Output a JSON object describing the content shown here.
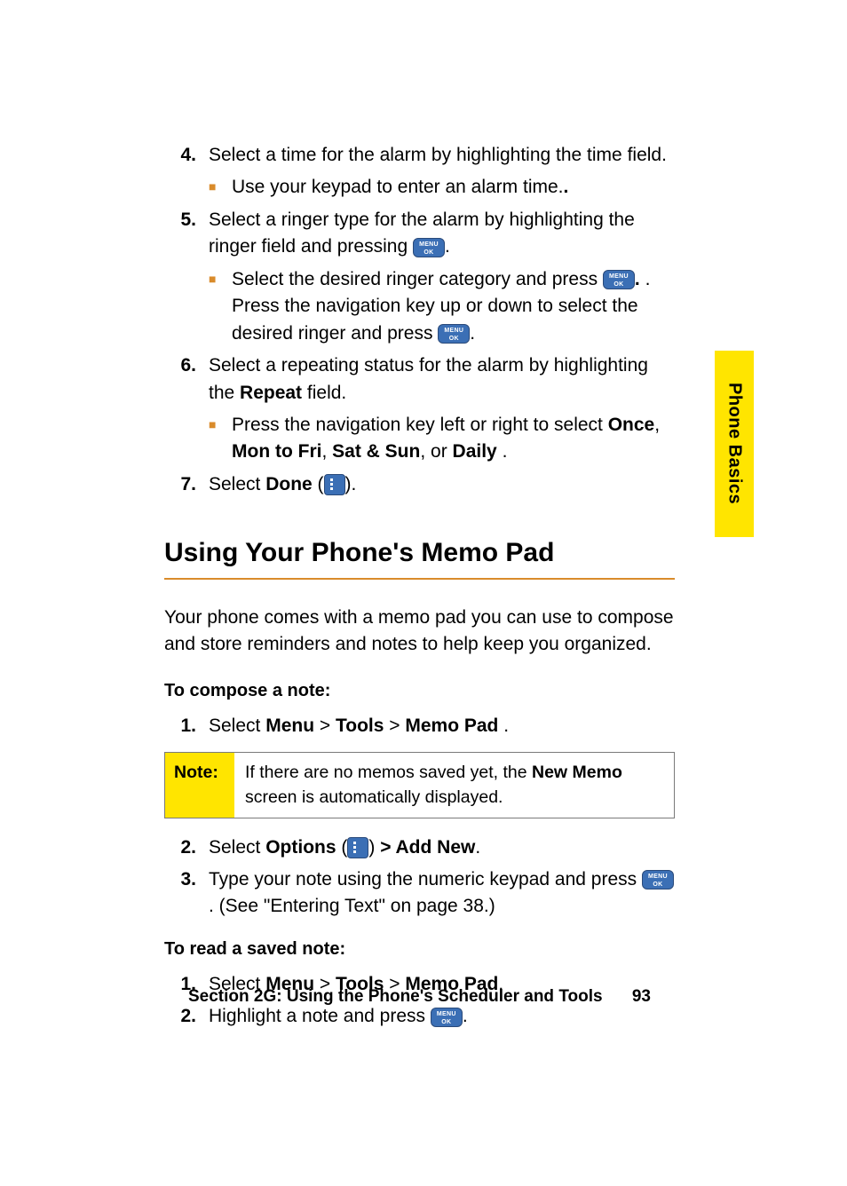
{
  "side_tab": "Phone Basics",
  "steps_top": {
    "s4": {
      "num": "4.",
      "text": "Select a time for the alarm by highlighting the time field.",
      "sub": "Use your keypad to enter an alarm time."
    },
    "s5": {
      "num": "5.",
      "text": "Select a ringer type for the alarm by highlighting the ringer field and pressing ",
      "text_tail": ".",
      "sub_a": "Select the desired ringer category and press ",
      "sub_a_tail": ". Press the navigation key up or down to select the desired ringer and press ",
      "sub_a_tail2": "."
    },
    "s6": {
      "num": "6.",
      "text": "Select a repeating status for the alarm by highlighting the ",
      "bold1": "Repeat",
      "text_tail": " field.",
      "sub_a_pre": "Press the navigation key left or right to select ",
      "opt1": "Once",
      "sep1": ", ",
      "opt2": "Mon to Fri",
      "sep2": ", ",
      "opt3": "Sat & Sun",
      "sep3": ", or ",
      "opt4": "Daily ",
      "sub_a_tail": "."
    },
    "s7": {
      "num": "7.",
      "pre": "Select ",
      "bold": "Done",
      "mid": " (",
      "tail": ")."
    }
  },
  "heading": "Using Your Phone's Memo Pad",
  "intro": "Your phone comes with a memo pad you can use to compose and store reminders and notes to help keep you organized.",
  "compose": {
    "leadin": "To compose a note:",
    "s1": {
      "num": "1.",
      "pre": "Select ",
      "m1": "Menu",
      "gt1": " > ",
      "m2": "Tools",
      "gt2": " > ",
      "m3": "Memo Pad ",
      "tail": "."
    },
    "note_label": "Note:",
    "note_pre": "If there are no memos saved yet, the ",
    "note_bold": "New Memo",
    "note_post": " screen is automatically displayed.",
    "s2": {
      "num": "2.",
      "pre": "Select ",
      "b1": "Options",
      "mid1": " (",
      "mid2": ") ",
      "gt": "> ",
      "b2": "Add New",
      "tail": "."
    },
    "s3": {
      "num": "3.",
      "pre": "Type your note using the numeric keypad and press ",
      "post": ". (See \"Entering Text\" on page 38.)"
    }
  },
  "read": {
    "leadin": "To read a saved note:",
    "s1": {
      "num": "1.",
      "pre": "Select ",
      "m1": "Menu",
      "gt1": " > ",
      "m2": "Tools",
      "gt2": " > ",
      "m3": "Memo Pad",
      "tail": "."
    },
    "s2": {
      "num": "2.",
      "pre": "Highlight a note and press ",
      "tail": "."
    }
  },
  "footer": {
    "section": "Section 2G: Using the Phone's Scheduler and Tools",
    "page": "93"
  }
}
